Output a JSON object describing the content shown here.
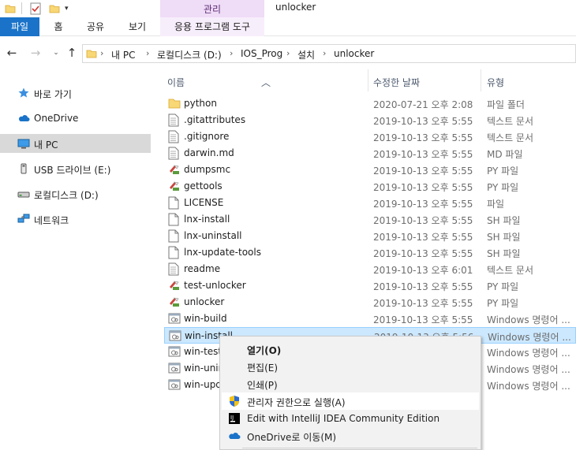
{
  "window": {
    "title": "unlocker",
    "manage_tab": "관리"
  },
  "ribbon": {
    "tabs": [
      {
        "label": "파일"
      },
      {
        "label": "홈"
      },
      {
        "label": "공유"
      },
      {
        "label": "보기"
      },
      {
        "label": "응용 프로그램 도구"
      }
    ]
  },
  "address": {
    "crumbs": [
      "내 PC",
      "로컬디스크 (D:)",
      "IOS_Prog",
      "설치",
      "unlocker"
    ]
  },
  "sidebar": {
    "items": [
      {
        "label": "바로 가기",
        "icon": "star-icon"
      },
      {
        "label": "OneDrive",
        "icon": "cloud-icon"
      },
      {
        "label": "내 PC",
        "icon": "computer-icon",
        "selected": true
      },
      {
        "label": "USB 드라이브 (E:)",
        "icon": "usb-drive-icon"
      },
      {
        "label": "로컬디스크 (D:)",
        "icon": "drive-icon"
      },
      {
        "label": "네트워크",
        "icon": "network-icon"
      }
    ]
  },
  "columns": {
    "name": "이름",
    "date": "수정한 날짜",
    "type": "유형"
  },
  "files": [
    {
      "name": "python",
      "date": "2020-07-21 오후 2:08",
      "type": "파일 폴더",
      "icon": "folder-icon"
    },
    {
      "name": ".gitattributes",
      "date": "2019-10-13 오후 5:55",
      "type": "텍스트 문서",
      "icon": "text-file-icon"
    },
    {
      "name": ".gitignore",
      "date": "2019-10-13 오후 5:55",
      "type": "텍스트 문서",
      "icon": "text-file-icon"
    },
    {
      "name": "darwin.md",
      "date": "2019-10-13 오후 5:55",
      "type": "MD 파일",
      "icon": "text-file-icon"
    },
    {
      "name": "dumpsmc",
      "date": "2019-10-13 오후 5:55",
      "type": "PY 파일",
      "icon": "python-file-icon"
    },
    {
      "name": "gettools",
      "date": "2019-10-13 오후 5:55",
      "type": "PY 파일",
      "icon": "python-file-icon"
    },
    {
      "name": "LICENSE",
      "date": "2019-10-13 오후 5:55",
      "type": "파일",
      "icon": "blank-file-icon"
    },
    {
      "name": "lnx-install",
      "date": "2019-10-13 오후 5:55",
      "type": "SH 파일",
      "icon": "blank-file-icon"
    },
    {
      "name": "lnx-uninstall",
      "date": "2019-10-13 오후 5:55",
      "type": "SH 파일",
      "icon": "blank-file-icon"
    },
    {
      "name": "lnx-update-tools",
      "date": "2019-10-13 오후 5:55",
      "type": "SH 파일",
      "icon": "blank-file-icon"
    },
    {
      "name": "readme",
      "date": "2019-10-13 오후 6:01",
      "type": "텍스트 문서",
      "icon": "text-file-icon"
    },
    {
      "name": "test-unlocker",
      "date": "2019-10-13 오후 5:55",
      "type": "PY 파일",
      "icon": "python-file-icon"
    },
    {
      "name": "unlocker",
      "date": "2019-10-13 오후 5:55",
      "type": "PY 파일",
      "icon": "python-file-icon"
    },
    {
      "name": "win-build",
      "date": "2019-10-13 오후 5:55",
      "type": "Windows 명령어 ...",
      "icon": "batch-file-icon"
    },
    {
      "name": "win-install",
      "date": "2019-10-13 오후 5:56",
      "type": "Windows 명령어 ...",
      "icon": "batch-file-icon",
      "selected": true
    },
    {
      "name": "win-test",
      "date": "",
      "type": "Windows 명령어 ...",
      "icon": "batch-file-icon"
    },
    {
      "name": "win-unin",
      "date": "",
      "type": "Windows 명령어 ...",
      "icon": "batch-file-icon"
    },
    {
      "name": "win-upd",
      "date": "",
      "type": "Windows 명령어 ...",
      "icon": "batch-file-icon"
    }
  ],
  "context_menu": {
    "items": [
      {
        "label": "열기(O)",
        "bold": true
      },
      {
        "label": "편집(E)"
      },
      {
        "label": "인쇄(P)"
      },
      {
        "label": "관리자 권한으로 실행(A)",
        "icon": "uac-shield-icon",
        "hover": true
      },
      {
        "label": "Edit with IntelliJ IDEA Community Edition",
        "icon": "intellij-icon"
      },
      {
        "label": "OneDrive로 이동(M)",
        "icon": "onedrive-icon"
      }
    ]
  },
  "colors": {
    "accent": "#1a73c9",
    "manage_tab": "#efdcf7",
    "selection": "#cce8ff",
    "sidebar_selected": "#d9d9d9"
  }
}
